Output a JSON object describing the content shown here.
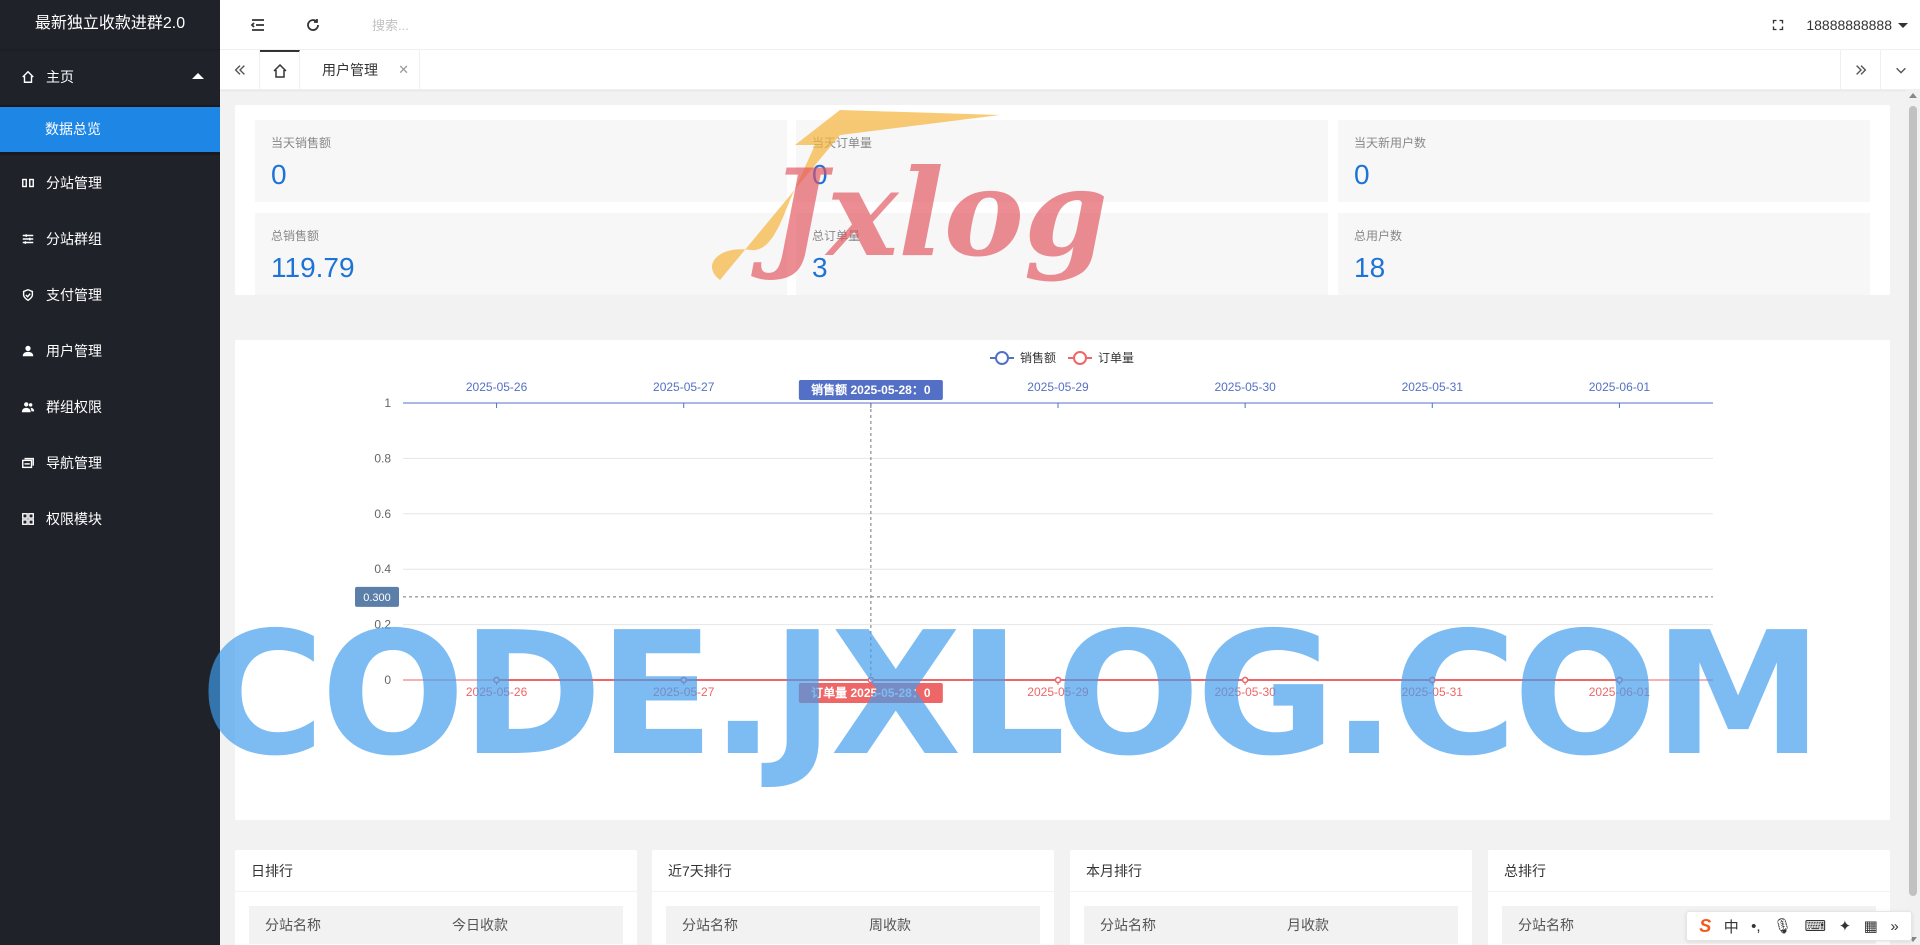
{
  "app": {
    "title": "最新独立收款进群2.0"
  },
  "sidebar": {
    "items": [
      {
        "label": "主页",
        "icon": "home-icon",
        "expanded": true
      },
      {
        "label": "分站管理",
        "icon": "columns-icon"
      },
      {
        "label": "分站群组",
        "icon": "sliders-icon"
      },
      {
        "label": "支付管理",
        "icon": "shield-check-icon"
      },
      {
        "label": "用户管理",
        "icon": "user-icon"
      },
      {
        "label": "群组权限",
        "icon": "users-icon"
      },
      {
        "label": "导航管理",
        "icon": "navigation-icon"
      },
      {
        "label": "权限模块",
        "icon": "grid-icon"
      }
    ],
    "sub_items": [
      {
        "label": "数据总览",
        "active": true
      }
    ],
    "accent_color": "#1e86e4",
    "bg_color": "#20222a"
  },
  "header": {
    "search_placeholder": "搜索...",
    "user": "18888888888"
  },
  "tabs": {
    "items": [
      {
        "label": "用户管理"
      }
    ]
  },
  "stats": [
    {
      "label": "当天销售额",
      "value": "0"
    },
    {
      "label": "当天订单量",
      "value": "0"
    },
    {
      "label": "当天新用户数",
      "value": "0"
    },
    {
      "label": "总销售额",
      "value": "119.79"
    },
    {
      "label": "总订单量",
      "value": "3"
    },
    {
      "label": "总用户数",
      "value": "18"
    }
  ],
  "chart_data": {
    "type": "line",
    "x": [
      "2025-05-26",
      "2025-05-27",
      "2025-05-28",
      "2025-05-29",
      "2025-05-30",
      "2025-05-31",
      "2025-06-01"
    ],
    "series": [
      {
        "name": "销售额",
        "values": [
          0,
          0,
          0,
          0,
          0,
          0,
          0
        ],
        "color": "#5470c6"
      },
      {
        "name": "订单量",
        "values": [
          0,
          0,
          0,
          0,
          0,
          0,
          0
        ],
        "color": "#ee6666"
      }
    ],
    "yticks": [
      "0",
      "0.2",
      "0.4",
      "0.6",
      "0.8",
      "1"
    ],
    "ylim": [
      0,
      1
    ],
    "legend": "top-center",
    "tooltip": {
      "top_label": "销售额  2025-05-28：0",
      "bottom_label": "订单量  2025-05-28：0",
      "y_pointer": "0.300",
      "y_pointer_value": 0.3,
      "x_index": 2
    }
  },
  "rankings": [
    {
      "title": "日排行",
      "col1": "分站名称",
      "col2": "今日收款"
    },
    {
      "title": "近7天排行",
      "col1": "分站名称",
      "col2": "周收款"
    },
    {
      "title": "本月排行",
      "col1": "分站名称",
      "col2": "月收款"
    },
    {
      "title": "总排行",
      "col1": "分站名称",
      "col2": ""
    }
  ],
  "watermarks": {
    "logo": "Jxlog",
    "banner": "CODE.JXLOG.COM"
  },
  "ime": {
    "brand": "S",
    "mode": "中"
  }
}
